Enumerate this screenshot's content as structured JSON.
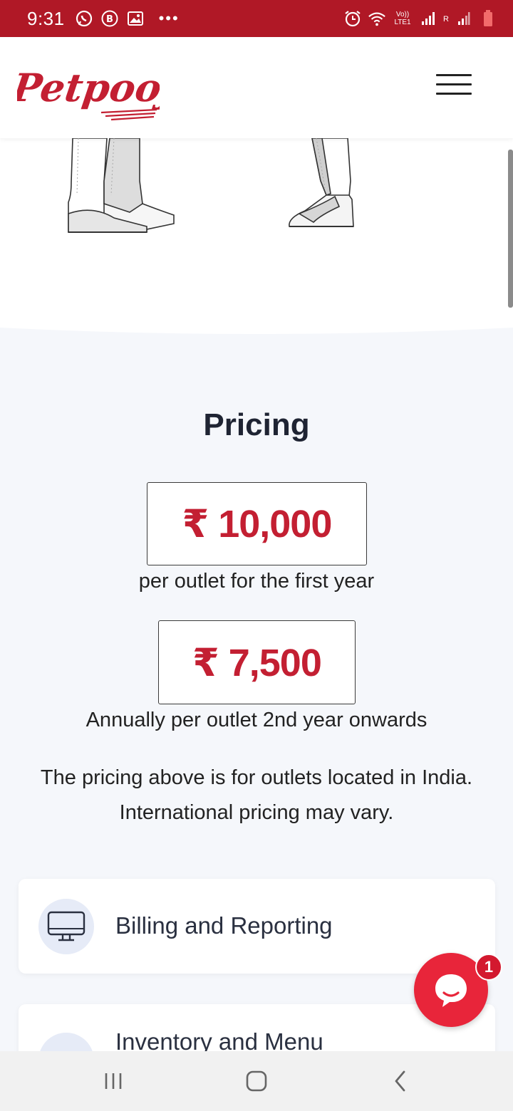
{
  "status_bar": {
    "time": "9:31",
    "network_label": "Vo)) LTE1",
    "roaming_label": "R"
  },
  "header": {
    "logo_text": "Petpooja",
    "brand_color": "#c31f32"
  },
  "pricing": {
    "title": "Pricing",
    "first_year_price": "₹ 10,000",
    "first_year_caption": "per outlet for the first year",
    "renewal_price": "₹ 7,500",
    "renewal_caption": "Annually per outlet 2nd year onwards",
    "note_line1": "The pricing above is for outlets located in India.",
    "note_line2": "International pricing may vary."
  },
  "features": [
    {
      "label": "Billing and Reporting",
      "icon": "monitor-icon"
    },
    {
      "label": "Inventory and Menu",
      "icon": "inventory-icon"
    }
  ],
  "chat": {
    "badge_count": "1",
    "color": "#e8253a"
  }
}
